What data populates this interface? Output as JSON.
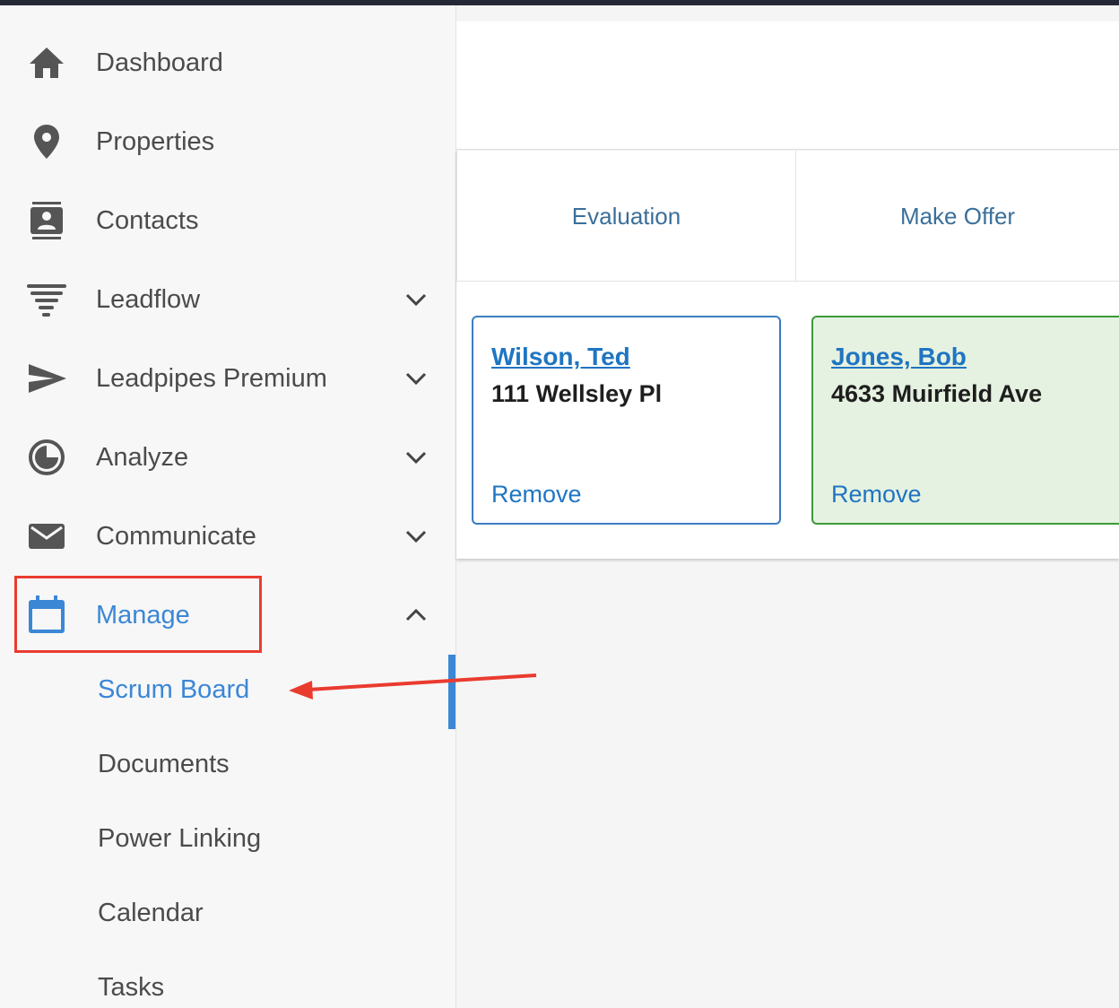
{
  "sidebar": {
    "items": [
      {
        "label": "Dashboard",
        "icon": "home-icon"
      },
      {
        "label": "Properties",
        "icon": "map-pin-icon"
      },
      {
        "label": "Contacts",
        "icon": "contact-card-icon"
      },
      {
        "label": "Leadflow",
        "icon": "tornado-icon",
        "expandable": true
      },
      {
        "label": "Leadpipes Premium",
        "icon": "send-icon",
        "expandable": true
      },
      {
        "label": "Analyze",
        "icon": "pie-chart-icon",
        "expandable": true
      },
      {
        "label": "Communicate",
        "icon": "envelope-icon",
        "expandable": true
      },
      {
        "label": "Manage",
        "icon": "calendar-icon",
        "expandable": true,
        "expanded": true,
        "active": true
      }
    ],
    "manage_subitems": [
      {
        "label": "Scrum Board",
        "active": true
      },
      {
        "label": "Documents"
      },
      {
        "label": "Power Linking"
      },
      {
        "label": "Calendar"
      },
      {
        "label": "Tasks"
      }
    ]
  },
  "board": {
    "columns": [
      {
        "title": "Evaluation",
        "cards": [
          {
            "name": "Wilson, Ted",
            "address": "111 Wellsley Pl",
            "action": "Remove"
          }
        ]
      },
      {
        "title": "Make Offer",
        "cards": [
          {
            "name": "Jones, Bob",
            "address": "4633 Muirfield Ave",
            "action": "Remove"
          }
        ]
      }
    ]
  },
  "colors": {
    "accent": "#3b87d6",
    "link": "#1f75c2",
    "annotation": "#ea3b2f",
    "card_green_bg": "#e6f2e1",
    "card_green_border": "#3a9a3a"
  }
}
